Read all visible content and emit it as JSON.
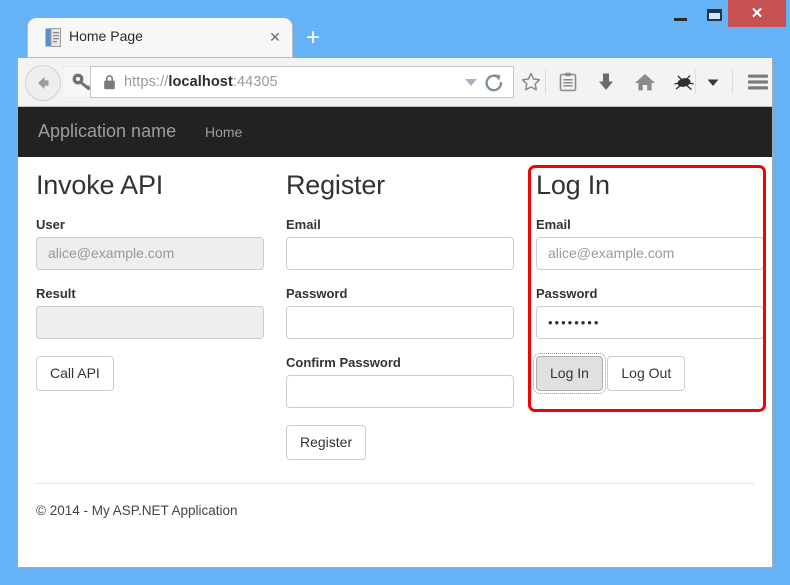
{
  "window": {
    "minimize_label": "–",
    "maximize_label": "",
    "close_label": "✕"
  },
  "browser": {
    "tab": {
      "title": "Home Page",
      "close_label": "✕",
      "favicon_name": "page-favicon"
    },
    "new_tab_label": "+",
    "urlbar": {
      "scheme": "https://",
      "host": "localhost",
      "port": ":44305",
      "full_url": "https://localhost:44305"
    },
    "toolbar_icons": [
      "back-icon",
      "forward-icon",
      "lock-icon",
      "url-dropdown-icon",
      "reload-icon",
      "star-icon",
      "reader-icon",
      "download-icon",
      "home-icon",
      "addon-icon",
      "overflow-caret-icon",
      "hamburger-menu-icon"
    ]
  },
  "page": {
    "navbar": {
      "brand": "Application name",
      "links": [
        "Home"
      ]
    },
    "columns": {
      "invoke_api": {
        "title": "Invoke API",
        "user_label": "User",
        "user_value": "alice@example.com",
        "user_disabled": true,
        "result_label": "Result",
        "result_value": "",
        "result_disabled": true,
        "call_api_button": "Call API"
      },
      "register": {
        "title": "Register",
        "email_label": "Email",
        "email_value": "",
        "password_label": "Password",
        "password_value": "",
        "confirm_password_label": "Confirm Password",
        "confirm_password_value": "",
        "register_button": "Register"
      },
      "login": {
        "title": "Log In",
        "email_label": "Email",
        "email_value": "alice@example.com",
        "password_label": "Password",
        "password_value": "••••••••",
        "login_button": "Log In",
        "logout_button": "Log Out",
        "highlight_color": "#f70000"
      }
    },
    "footer": {
      "copyright": "© 2014 - My ASP.NET Application"
    }
  }
}
